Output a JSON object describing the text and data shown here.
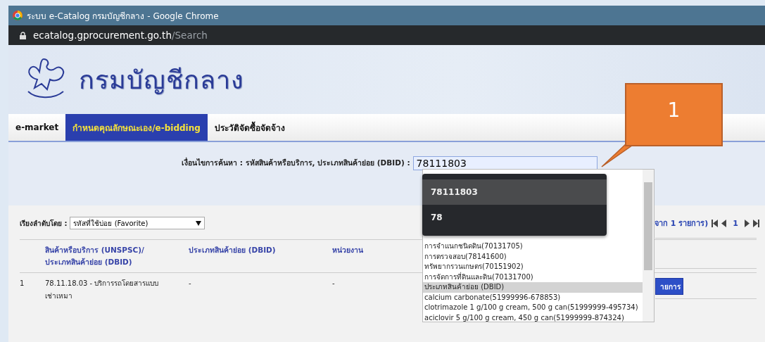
{
  "window": {
    "title": "ระบบ e-Catalog กรมบัญชีกลาง - Google Chrome"
  },
  "address_bar": {
    "host": "ecatalog.gprocurement.go.th",
    "path": "/Search"
  },
  "banner": {
    "title": "กรมบัญชีกลาง"
  },
  "tabs": [
    {
      "label": "e-market",
      "selected": false
    },
    {
      "label": "กำหนดคุณลักษณะเอง/e-bidding",
      "selected": true
    },
    {
      "label": "ประวัติจัดซื้อจัดจ้าง",
      "selected": false
    }
  ],
  "search": {
    "label": "เงื่อนไขการค้นหา : รหัสสินค้าหรือบริการ, ประเภทสินค้าย่อย (DBID) :",
    "value": "78111803"
  },
  "sort": {
    "label": "เรียงลำดับโดย :",
    "value": "รหัสที่ใช้บ่อย (Favorite)"
  },
  "pagination": {
    "summary": "จาก 1 รายการ)",
    "page": "1"
  },
  "table": {
    "columns": [
      "สินค้าหรือบริการ (UNSPSC)/ ประเภทสินค้าย่อย (DBID)",
      "ประเภทสินค้าย่อย (DBID)",
      "หน่วยงาน"
    ],
    "rows": [
      {
        "index": "1",
        "cells": [
          "78.11.18.03 - บริการรถโดยสารแบบเช่าเหมา",
          "-",
          "-"
        ],
        "button": "ายการ"
      }
    ]
  },
  "listbox": {
    "items": [
      {
        "kind": "item",
        "label": "การจำแนกชนิดดิน(70131705)"
      },
      {
        "kind": "item",
        "label": "การตรวจสอบ(78141600)"
      },
      {
        "kind": "item",
        "label": "ทรัพยากรวนเกษตร(70151902)"
      },
      {
        "kind": "item",
        "label": "การจัดการที่ดินและดิน(70131700)"
      },
      {
        "kind": "group",
        "label": "ประเภทสินค้าย่อย (DBID)"
      },
      {
        "kind": "item",
        "label": "calcium carbonate(51999996-678853)"
      },
      {
        "kind": "item",
        "label": "clotrimazole 1 g/100 g cream, 500 g can(51999999-495734)"
      },
      {
        "kind": "item",
        "label": "aciclovir 5 g/100 g cream, 450 g can(51999999-874324)"
      }
    ]
  },
  "autocomplete": [
    {
      "label": "78111803",
      "selected": true
    },
    {
      "label": "78",
      "selected": false
    }
  ],
  "callout": {
    "label": "1"
  }
}
